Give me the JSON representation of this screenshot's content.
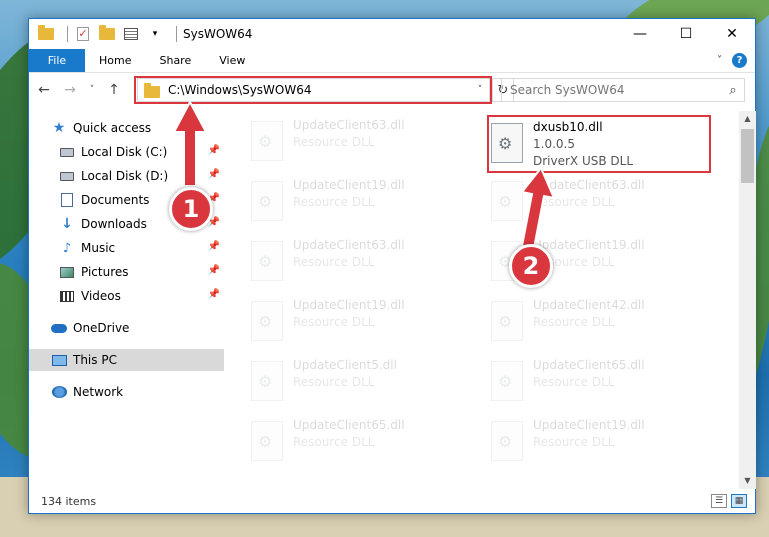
{
  "window": {
    "title": "SysWOW64",
    "controls": {
      "minimize": "—",
      "maximize": "☐",
      "close": "✕"
    }
  },
  "ribbon": {
    "tabs": [
      "File",
      "Home",
      "Share",
      "View"
    ],
    "chevron": "˅",
    "help": "?"
  },
  "nav": {
    "back": "←",
    "forward": "→",
    "recent": "˅",
    "up": "↑",
    "address": "C:\\Windows\\SysWOW64",
    "address_dropdown": "˅",
    "refresh": "↻",
    "search_placeholder": "Search SysWOW64",
    "search_icon": "⌕"
  },
  "sidebar": {
    "items": [
      {
        "label": "Quick access",
        "icon": "star-icon"
      },
      {
        "label": "Local Disk (C:)",
        "icon": "drive-icon"
      },
      {
        "label": "Local Disk (D:)",
        "icon": "drive-icon"
      },
      {
        "label": "Documents",
        "icon": "documents-icon"
      },
      {
        "label": "Downloads",
        "icon": "downloads-icon"
      },
      {
        "label": "Music",
        "icon": "music-icon"
      },
      {
        "label": "Pictures",
        "icon": "pictures-icon"
      },
      {
        "label": "Videos",
        "icon": "videos-icon"
      },
      {
        "label": "OneDrive",
        "icon": "onedrive-icon"
      },
      {
        "label": "This PC",
        "icon": "this-pc-icon"
      },
      {
        "label": "Network",
        "icon": "network-icon"
      }
    ],
    "pin_glyph": "📌",
    "selected": "This PC"
  },
  "files": {
    "highlighted": {
      "name": "dxusb10.dll",
      "version": "1.0.0.5",
      "description": "DriverX USB DLL"
    },
    "left_column": [
      {
        "name": "UpdateClient63.dll",
        "description": "Resource DLL"
      },
      {
        "name": "UpdateClient19.dll",
        "description": "Resource DLL"
      },
      {
        "name": "UpdateClient63.dll",
        "description": "Resource DLL"
      },
      {
        "name": "UpdateClient19.dll",
        "description": "Resource DLL"
      },
      {
        "name": "UpdateClient5.dll",
        "description": "Resource DLL"
      },
      {
        "name": "UpdateClient65.dll",
        "description": "Resource DLL"
      }
    ],
    "right_column": [
      {
        "name": "UpdateClient63.dll",
        "description": "Resource DLL"
      },
      {
        "name": "UpdateClient19.dll",
        "description": "Resource DLL"
      },
      {
        "name": "UpdateClient42.dll",
        "description": "Resource DLL"
      },
      {
        "name": "UpdateClient65.dll",
        "description": "Resource DLL"
      },
      {
        "name": "UpdateClient19.dll",
        "description": "Resource DLL"
      }
    ]
  },
  "scrollbar": {
    "up": "▲",
    "down": "▼"
  },
  "status": {
    "item_count": "134 items",
    "view_details": "☰",
    "view_tiles": "▦"
  },
  "annotations": {
    "step1": "1",
    "step2": "2"
  },
  "colors": {
    "accent": "#1979ca",
    "highlight": "#d9363e"
  }
}
